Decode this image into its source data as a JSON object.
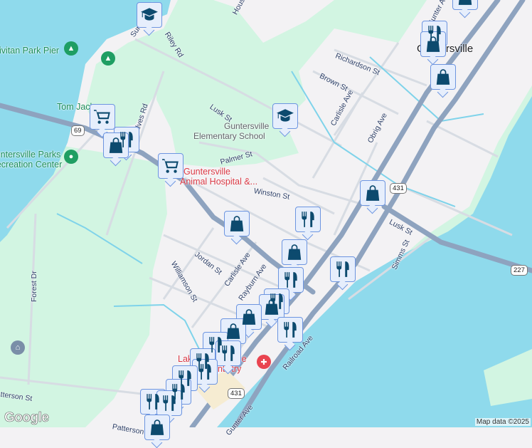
{
  "places": {
    "civitan_park_pier": "Civitan Park Pier",
    "tom_jackson": "Tom Jackson",
    "parks_rec": "Guntersville Parks & Recreation Center",
    "parks_rec_line1": "Guntersville Parks",
    "parks_rec_line2": "& Recreation Center",
    "elementary_line1": "Guntersville",
    "elementary_line2": "Elementary School",
    "animal_line1": "Guntersville",
    "animal_line2": "Animal Hospital &...",
    "city": "Guntersville",
    "dentistry_line1": "Lake Guntersville",
    "dentistry_line2": "Dentistry"
  },
  "streets": {
    "sunset_trail": "Sunset Trail",
    "riley": "Riley Rd",
    "lusk1": "Lusk St",
    "alves": "Alves Rd",
    "palmer": "Palmer St",
    "winston": "Winston St",
    "richardson": "Richardson St",
    "brown": "Brown St",
    "carlisle1": "Carlisle Ave",
    "obrig": "Obrig Ave",
    "lusk2": "Lusk St",
    "simms": "Simms St",
    "jordan": "Jordan St",
    "williamson": "Williamson St",
    "carlisle2": "Carlisle Ave",
    "rayburn": "Rayburn Ave",
    "forest": "Forest Dr",
    "patterson": "Patterson St",
    "patterson2": "Patterson St",
    "railroad": "Railroad Ave",
    "houston": "Houston St",
    "gunter": "Gunter Ave",
    "gunter2": "Gunter Ave"
  },
  "shields": {
    "r69": "69",
    "r431a": "431",
    "r431b": "431",
    "r227": "227"
  },
  "attribution": {
    "logo": "Google",
    "copyright": "Map data ©2025"
  },
  "colors": {
    "water": "#8fdaec",
    "park": "#d2f5e2",
    "land": "#f3f2f4",
    "road": "#8ea3bf",
    "pin_fill": "#e6eefc",
    "pin_icon": "#0c4a6e"
  }
}
